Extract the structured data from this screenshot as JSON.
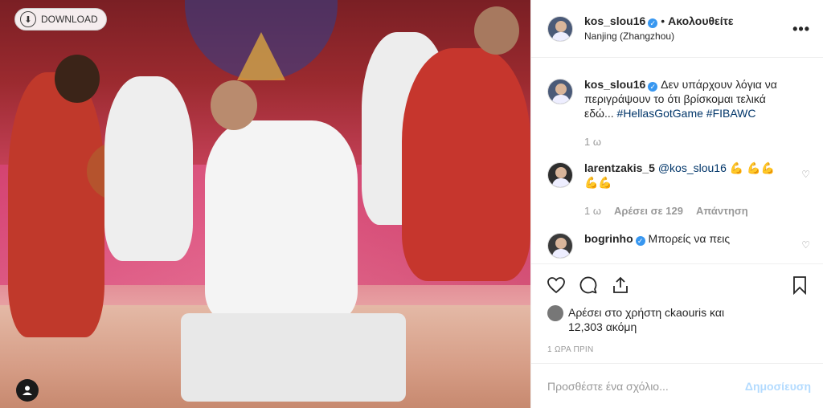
{
  "photo": {
    "download_label": "DOWNLOAD"
  },
  "post": {
    "username": "kos_slou16",
    "follow_label": "Ακολουθείτε",
    "location": "Nanjing (Zhangzhou)",
    "more_icon": "more-horizontal-icon"
  },
  "caption": {
    "username": "kos_slou16",
    "text": "Δεν υπάρχουν λόγια να περιγράψουν το ότι βρίσκομαι τελικά εδώ...",
    "hashtags": "#HellasGotGame #FIBAWC",
    "age": "1 ω"
  },
  "comments": [
    {
      "username": "larentzakis_5",
      "mention": "@kos_slou16",
      "emoji": "💪 💪💪💪💪",
      "age": "1 ω",
      "likes": "Αρέσει σε 129",
      "reply": "Απάντηση"
    },
    {
      "username": "bogrinho",
      "text": "Μπορείς να πεις"
    }
  ],
  "likes": {
    "line1": "Αρέσει στο χρήστη ckaouris και",
    "line2": "12,303 ακόμη"
  },
  "timestamp": "1 ΩΡΑ ΠΡΙΝ",
  "add_comment": {
    "placeholder": "Προσθέστε ένα σχόλιο...",
    "post_label": "Δημοσίευση"
  },
  "colors": {
    "link": "#003569",
    "verified": "#3897f0",
    "post_disabled": "#b3dbff"
  }
}
